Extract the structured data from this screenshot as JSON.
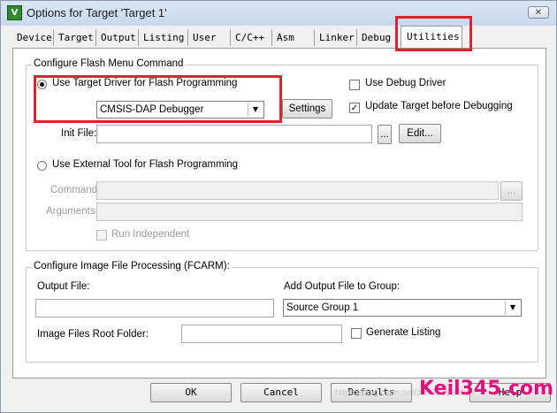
{
  "window": {
    "title": "Options for Target 'Target 1'",
    "app_icon": "keil-uv-icon",
    "close_glyph": "✕"
  },
  "tabs": [
    {
      "label": "Device"
    },
    {
      "label": "Target"
    },
    {
      "label": "Output"
    },
    {
      "label": "Listing"
    },
    {
      "label": "User"
    },
    {
      "label": "C/C++"
    },
    {
      "label": "Asm"
    },
    {
      "label": "Linker"
    },
    {
      "label": "Debug"
    },
    {
      "label": "Utilities"
    }
  ],
  "active_tab": "Utilities",
  "flash": {
    "group_title": "Configure Flash Menu Command",
    "use_target_driver": "Use Target Driver for Flash Programming",
    "driver_value": "CMSIS-DAP Debugger",
    "settings": "Settings",
    "use_debug_driver": "Use Debug Driver",
    "use_debug_driver_checked": false,
    "update_target": "Update Target before Debugging",
    "update_target_checked": true,
    "init_file_label": "Init File:",
    "init_file_value": "",
    "browse": "...",
    "edit": "Edit...",
    "use_external_tool": "Use External Tool for Flash Programming",
    "command_label": "Command:",
    "command_value": "",
    "arguments_label": "Arguments:",
    "arguments_value": "",
    "run_independent": "Run Independent",
    "run_independent_checked": false,
    "selected_option": "target_driver"
  },
  "image": {
    "group_title": "Configure Image File Processing (FCARM):",
    "output_file_label": "Output File:",
    "output_file_value": "",
    "add_output_label": "Add Output File  to Group:",
    "group_value": "Source Group 1",
    "root_folder_label": "Image Files Root Folder:",
    "root_folder_value": "",
    "generate_listing": "Generate Listing",
    "generate_listing_checked": false
  },
  "footer": {
    "ok": "OK",
    "cancel": "Cancel",
    "defaults": "Defaults",
    "help": "Help"
  },
  "watermark": {
    "brand": "Keil345.com",
    "faint": "https://blog.csdn.net/zhh763984017"
  },
  "colors": {
    "highlight_box": "#d9232e",
    "watermark": "#e0117a"
  }
}
